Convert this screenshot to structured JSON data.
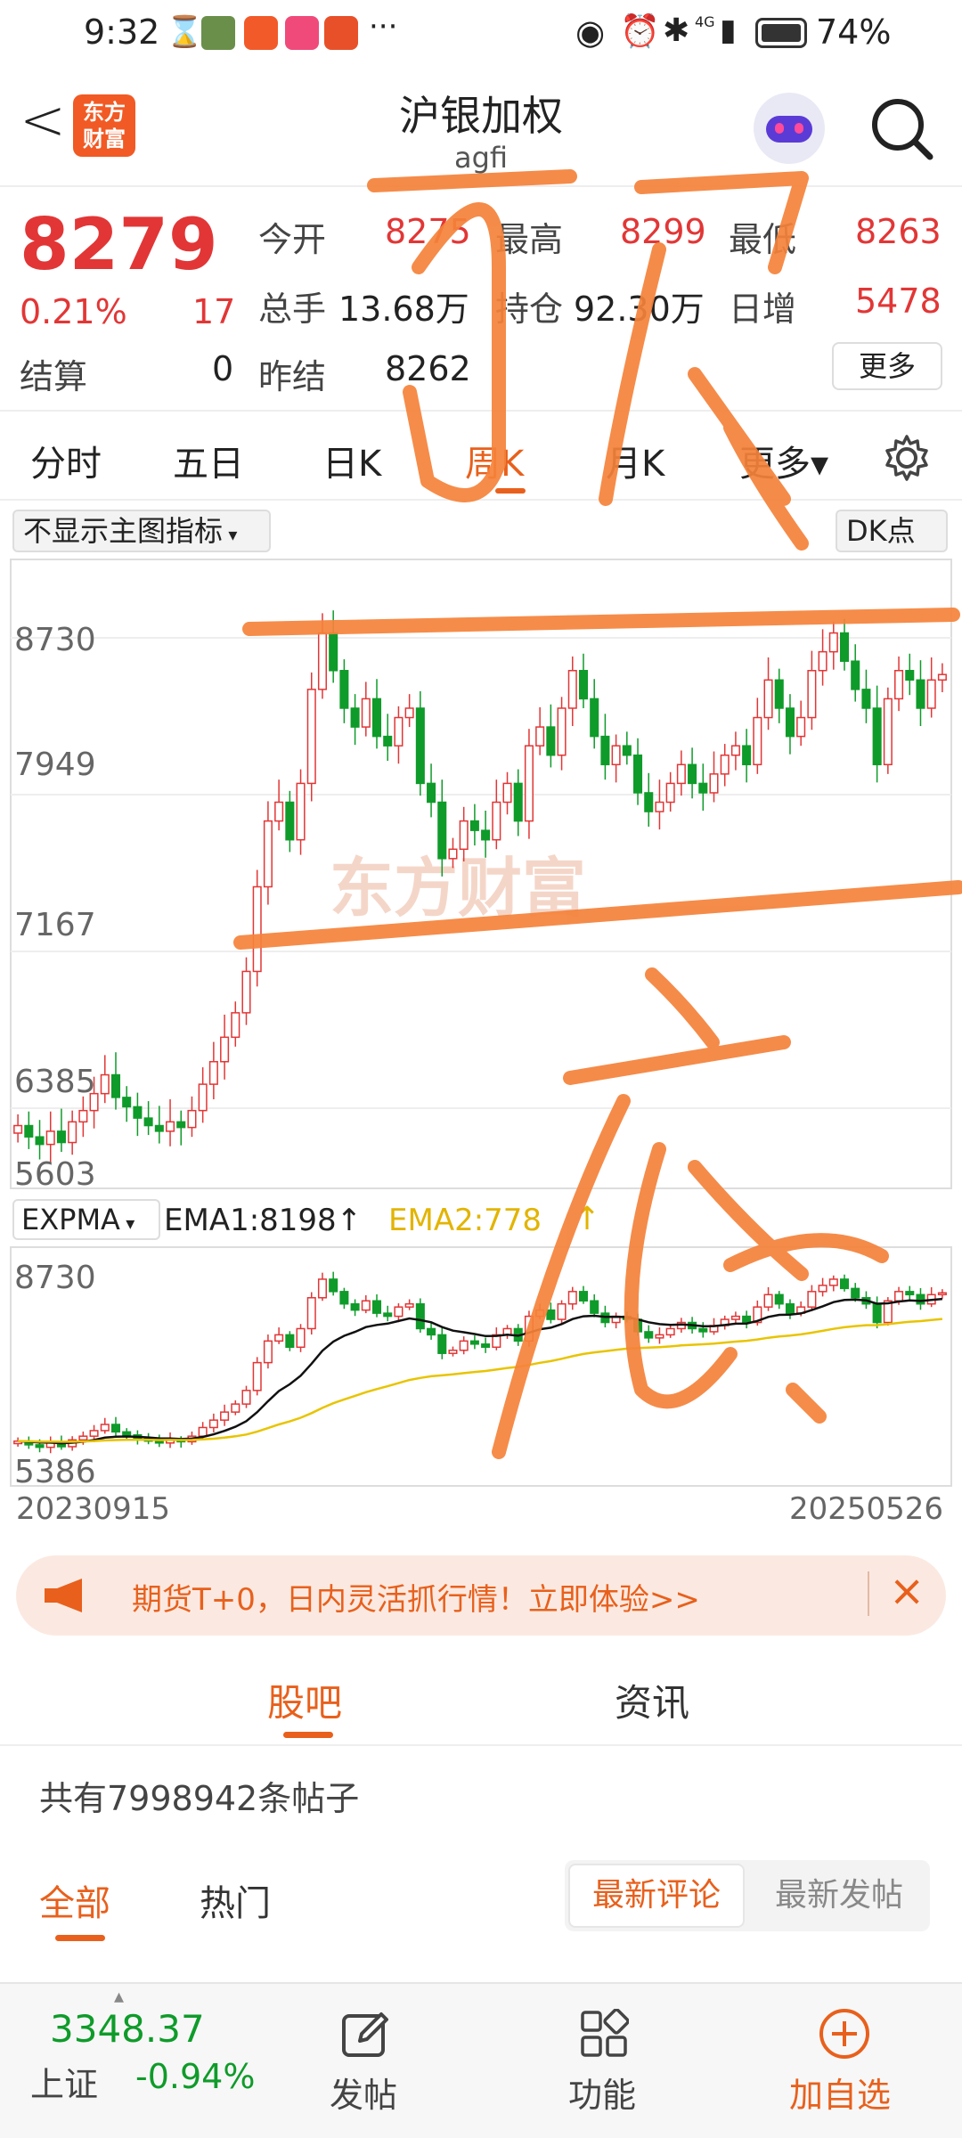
{
  "status_bar": {
    "time": "9:32",
    "network": "4G",
    "battery": "74%"
  },
  "header": {
    "back": "<",
    "logo_line1": "东方",
    "logo_line2": "财富",
    "title": "沪银加权",
    "subtitle": "agfi"
  },
  "quote": {
    "price": "8279",
    "change_pct": "0.21%",
    "change": "17",
    "settle_label": "结算",
    "settle": "0",
    "open_label": "今开",
    "open": "8275",
    "high_label": "最高",
    "high": "8299",
    "low_label": "最低",
    "low": "8263",
    "volume_label": "总手",
    "volume": "13.68万",
    "oi_label": "持仓",
    "oi": "92.30万",
    "daily_inc_label": "日增",
    "daily_inc": "5478",
    "prev_settle_label": "昨结",
    "prev_settle": "8262",
    "more_button": "更多"
  },
  "tabs": [
    "分时",
    "五日",
    "日K",
    "周K",
    "月K",
    "更多▾"
  ],
  "active_tab": "周K",
  "main_chart": {
    "indicator_select": "不显示主图指标",
    "dk_button": "DK点",
    "watermark": "东方财富",
    "y_labels": [
      "8730",
      "7949",
      "7167",
      "6385",
      "5603"
    ]
  },
  "sub_chart": {
    "indicator_select": "EXPMA",
    "ema1_label": "EMA1:8198↑",
    "ema2_label": "EMA2:778",
    "ema2_arrow": "↑",
    "y_labels": [
      "8730",
      "5386"
    ],
    "start_date": "20230915",
    "end_date": "20250526"
  },
  "handwriting": {
    "top_char": "顶",
    "bottom_char": "底"
  },
  "banner": {
    "text": "期货T+0，日内灵活抓行情！立即体验>>",
    "close": "×"
  },
  "bbs": {
    "tabs": [
      "股吧",
      "资讯"
    ],
    "active_tab": "股吧",
    "post_count_text": "共有7998942条帖子",
    "filter_tabs": [
      "全部",
      "热门"
    ],
    "sort_options": [
      "最新评论",
      "最新发帖"
    ]
  },
  "bottom_bar": {
    "index_value": "3348.37",
    "index_name": "上证",
    "index_change": "-0.94%",
    "post": "发帖",
    "functions": "功能",
    "add_watch": "加自选"
  },
  "chart_data": {
    "type": "candlestick",
    "title": "沪银加权 周K",
    "y_range": [
      5603,
      8730
    ],
    "x_range": [
      "20230915",
      "20250526"
    ],
    "closes": [
      5880,
      5820,
      5780,
      5850,
      5790,
      5900,
      5960,
      6050,
      6150,
      6030,
      5980,
      5920,
      5880,
      5850,
      5900,
      5870,
      5960,
      6100,
      6220,
      6350,
      6480,
      6700,
      7150,
      7500,
      7600,
      7400,
      7700,
      8200,
      8500,
      8300,
      8100,
      8000,
      8150,
      7950,
      7900,
      8050,
      8100,
      7700,
      7600,
      7300,
      7350,
      7500,
      7450,
      7400,
      7600,
      7700,
      7500,
      7900,
      8000,
      7850,
      8100,
      8300,
      8150,
      7950,
      7800,
      7900,
      7850,
      7650,
      7550,
      7600,
      7700,
      7800,
      7700,
      7650,
      7750,
      7850,
      7900,
      7800,
      8050,
      8250,
      8100,
      7950,
      8050,
      8300,
      8400,
      8500,
      8350,
      8200,
      8100,
      7800,
      8150,
      8300,
      8250,
      8100,
      8250,
      8279
    ],
    "ema1_last": 8198,
    "ema2_label_value": "778"
  }
}
